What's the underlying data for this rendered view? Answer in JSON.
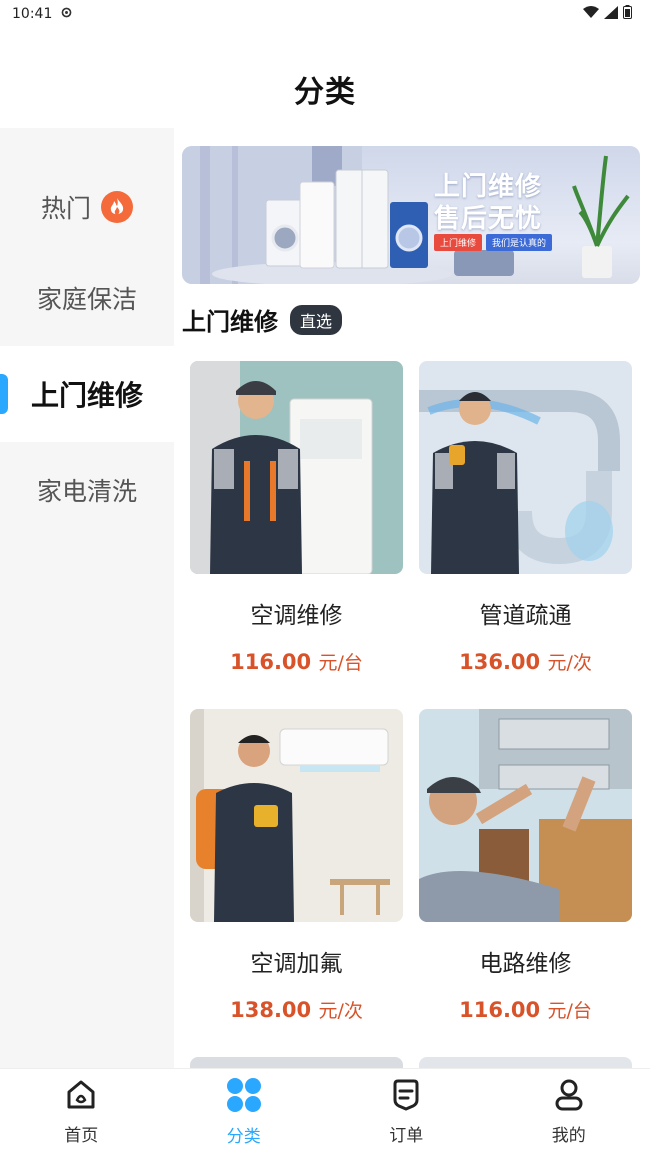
{
  "status": {
    "time": "10:41"
  },
  "header": {
    "title": "分类"
  },
  "sidebar": {
    "items": [
      {
        "label": "热门"
      },
      {
        "label": "家庭保洁"
      },
      {
        "label": "上门维修"
      },
      {
        "label": "家电清洗"
      }
    ],
    "active": "上门维修"
  },
  "banner": {
    "line1": "上门维修",
    "line2": "售后无忧",
    "tag1": "上门维修",
    "tag2": "我们是认真的"
  },
  "section": {
    "title": "上门维修",
    "badge": "直选"
  },
  "products": [
    {
      "name": "空调维修",
      "price": "116.00",
      "unit": "元/台"
    },
    {
      "name": "管道疏通",
      "price": "136.00",
      "unit": "元/次"
    },
    {
      "name": "空调加氟",
      "price": "138.00",
      "unit": "元/次"
    },
    {
      "name": "电路维修",
      "price": "116.00",
      "unit": "元/台"
    }
  ],
  "tabbar": {
    "items": [
      {
        "label": "首页",
        "icon": "home-icon"
      },
      {
        "label": "分类",
        "icon": "category-icon"
      },
      {
        "label": "订单",
        "icon": "order-icon"
      },
      {
        "label": "我的",
        "icon": "profile-icon"
      }
    ],
    "active_color": "#2aa7ff"
  }
}
